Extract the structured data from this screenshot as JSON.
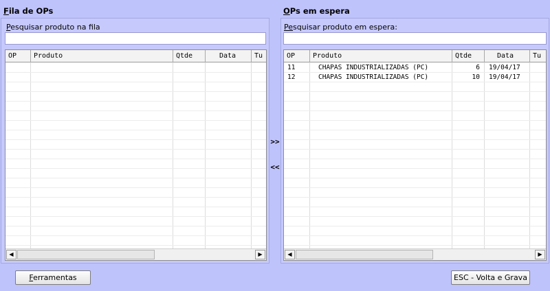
{
  "left_panel": {
    "title_first": "F",
    "title_rest": "ila de OPs",
    "search_label_first": "P",
    "search_label_rest": "esquisar produto na fila",
    "search_value": "",
    "columns": [
      "OP",
      "Produto",
      "Qtde",
      "Data",
      "Tu"
    ],
    "rows": []
  },
  "right_panel": {
    "title_first": "O",
    "title_rest": "Ps em espera",
    "search_label_first": "Pe",
    "search_label_rest": "squisar produto em espera:",
    "search_value": "",
    "columns": [
      "OP",
      "Produto",
      "Qtde",
      "Data",
      "Tu"
    ],
    "rows": [
      {
        "op": "11",
        "produto": "CHAPAS INDUSTRIALIZADAS (PC)",
        "qtde": "6",
        "data": "19/04/17"
      },
      {
        "op": "12",
        "produto": "CHAPAS INDUSTRIALIZADAS (PC)",
        "qtde": "10",
        "data": "19/04/17"
      }
    ]
  },
  "actions": {
    "move_right": ">>",
    "move_left": "<<",
    "tools_first": "F",
    "tools_rest": "erramentas",
    "esc_label": "ESC - Volta e Grava"
  },
  "scrollbar": {
    "left_arrow": "◀",
    "right_arrow": "▶"
  },
  "colors": {
    "background": "#bfc3fb",
    "grid_background": "#ffffff",
    "header_background": "#f3f3f3"
  }
}
